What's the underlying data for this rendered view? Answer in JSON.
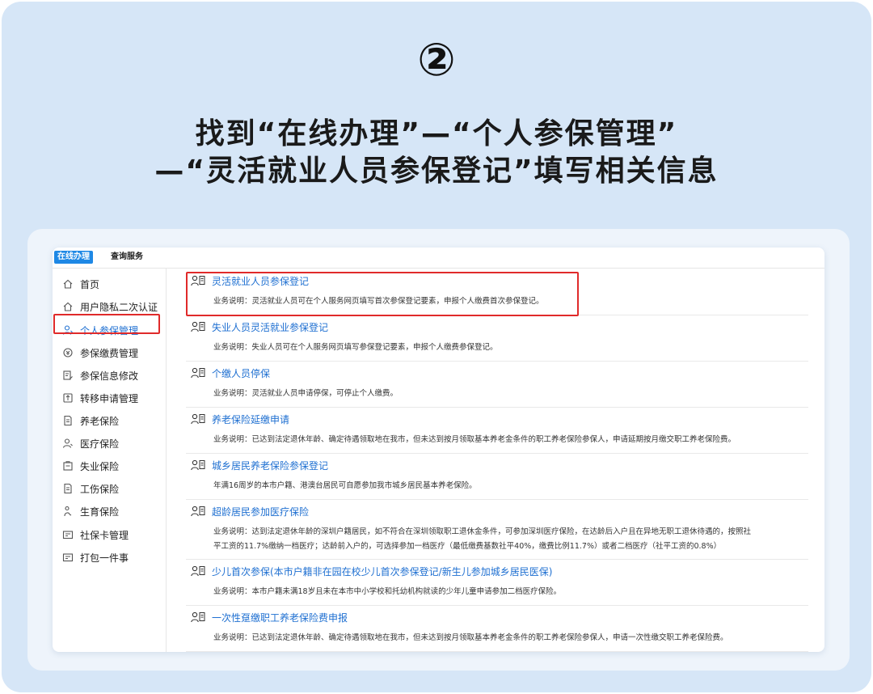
{
  "step_number": "②",
  "headline": {
    "line1": "找到“在线办理”—“个人参保管理”",
    "line2": "—“灵活就业人员参保登记”填写相关信息"
  },
  "tabs": {
    "active": "在线办理",
    "other": "查询服务"
  },
  "sidebar": {
    "items": [
      {
        "label": "首页",
        "icon": "home-icon"
      },
      {
        "label": "用户隐私二次认证",
        "icon": "home-icon"
      },
      {
        "label": "个人参保管理",
        "icon": "person-icon",
        "active": true
      },
      {
        "label": "参保缴费管理",
        "icon": "payment-icon"
      },
      {
        "label": "参保信息修改",
        "icon": "edit-icon"
      },
      {
        "label": "转移申请管理",
        "icon": "transfer-icon"
      },
      {
        "label": "养老保险",
        "icon": "document-icon"
      },
      {
        "label": "医疗保险",
        "icon": "person-icon"
      },
      {
        "label": "失业保险",
        "icon": "briefcase-icon"
      },
      {
        "label": "工伤保险",
        "icon": "document-icon"
      },
      {
        "label": "生育保险",
        "icon": "baby-icon"
      },
      {
        "label": "社保卡管理",
        "icon": "card-icon"
      },
      {
        "label": "打包一件事",
        "icon": "card-icon"
      }
    ]
  },
  "services": [
    {
      "title": "灵活就业人员参保登记",
      "desc": [
        "业务说明：灵活就业人员可在个人服务网页填写首次参保登记要素，申报个人缴费首次参保登记。"
      ]
    },
    {
      "title": "失业人员灵活就业参保登记",
      "desc": [
        "业务说明：失业人员可在个人服务网页填写参保登记要素，申报个人缴费参保登记。"
      ]
    },
    {
      "title": "个缴人员停保",
      "desc": [
        "业务说明：灵活就业人员申请停保，可停止个人缴费。"
      ]
    },
    {
      "title": "养老保险延缴申请",
      "desc": [
        "业务说明：已达到法定退休年龄、确定待遇领取地在我市，但未达到按月领取基本养老金条件的职工养老保险参保人，申请延期按月缴交职工养老保险费。"
      ]
    },
    {
      "title": "城乡居民养老保险参保登记",
      "desc": [
        "年满16周岁的本市户籍、港澳台居民可自愿参加我市城乡居民基本养老保险。"
      ]
    },
    {
      "title": "超龄居民参加医疗保险",
      "desc": [
        "业务说明：达到法定退休年龄的深圳户籍居民，如不符合在深圳领取职工退休金条件，可参加深圳医疗保险，在达龄后入户且在异地无职工退休待遇的，按照社",
        "平工资的11.7%缴纳一档医疗；达龄前入户的，可选择参加一档医疗（最低缴费基数社平40%，缴费比例11.7%）或者二档医疗（社平工资的0.8%）"
      ]
    },
    {
      "title": "少儿首次参保(本市户籍非在园在校少儿首次参保登记/新生儿参加城乡居民医保)",
      "desc": [
        "业务说明：本市户籍未满18岁且未在本市中小学校和托幼机构就读的少年儿童申请参加二档医疗保险。"
      ]
    },
    {
      "title": "一次性趸缴职工养老保险费申报",
      "desc": [
        "业务说明：已达到法定退休年龄、确定待遇领取地在我市，但未达到按月领取基本养老金条件的职工养老保险参保人，申请一次性缴交职工养老保险费。"
      ]
    }
  ],
  "colors": {
    "background": "#d6e6f7",
    "accent": "#1e88e5",
    "link": "#1e6fd1",
    "highlight": "#e02a2a"
  }
}
